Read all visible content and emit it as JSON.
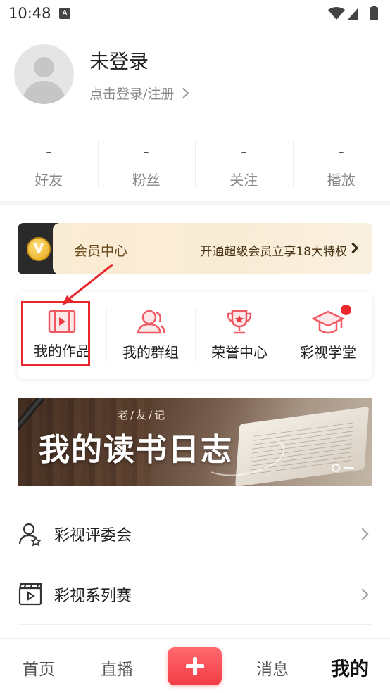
{
  "status_bar": {
    "time": "10:48",
    "notification_letter": "A"
  },
  "profile": {
    "name": "未登录",
    "login_prompt": "点击登录/注册"
  },
  "stats": [
    {
      "value": "-",
      "label": "好友"
    },
    {
      "value": "-",
      "label": "粉丝"
    },
    {
      "value": "-",
      "label": "关注"
    },
    {
      "value": "-",
      "label": "播放"
    }
  ],
  "vip": {
    "badge_letter": "V",
    "title": "会员中心",
    "promo": "开通超级会员立享18大特权"
  },
  "features": [
    {
      "label": "我的作品",
      "icon": "video-icon"
    },
    {
      "label": "我的群组",
      "icon": "group-icon"
    },
    {
      "label": "荣誉中心",
      "icon": "trophy-icon"
    },
    {
      "label": "彩视学堂",
      "icon": "graduation-cap-icon",
      "badge": "red-dot"
    }
  ],
  "book_banner": {
    "kicker": "老/友/记",
    "title": "我的读书日志"
  },
  "list": [
    {
      "label": "彩视评委会",
      "icon": "judge-user-icon"
    },
    {
      "label": "彩视系列赛",
      "icon": "clapperboard-icon"
    }
  ],
  "bottom_nav": {
    "home": "首页",
    "live": "直播",
    "messages": "消息",
    "mine": "我的"
  },
  "colors": {
    "accent_red": "#f23b44",
    "vip_bg": "#fbedd3",
    "highlight_red": "#e8262b"
  }
}
